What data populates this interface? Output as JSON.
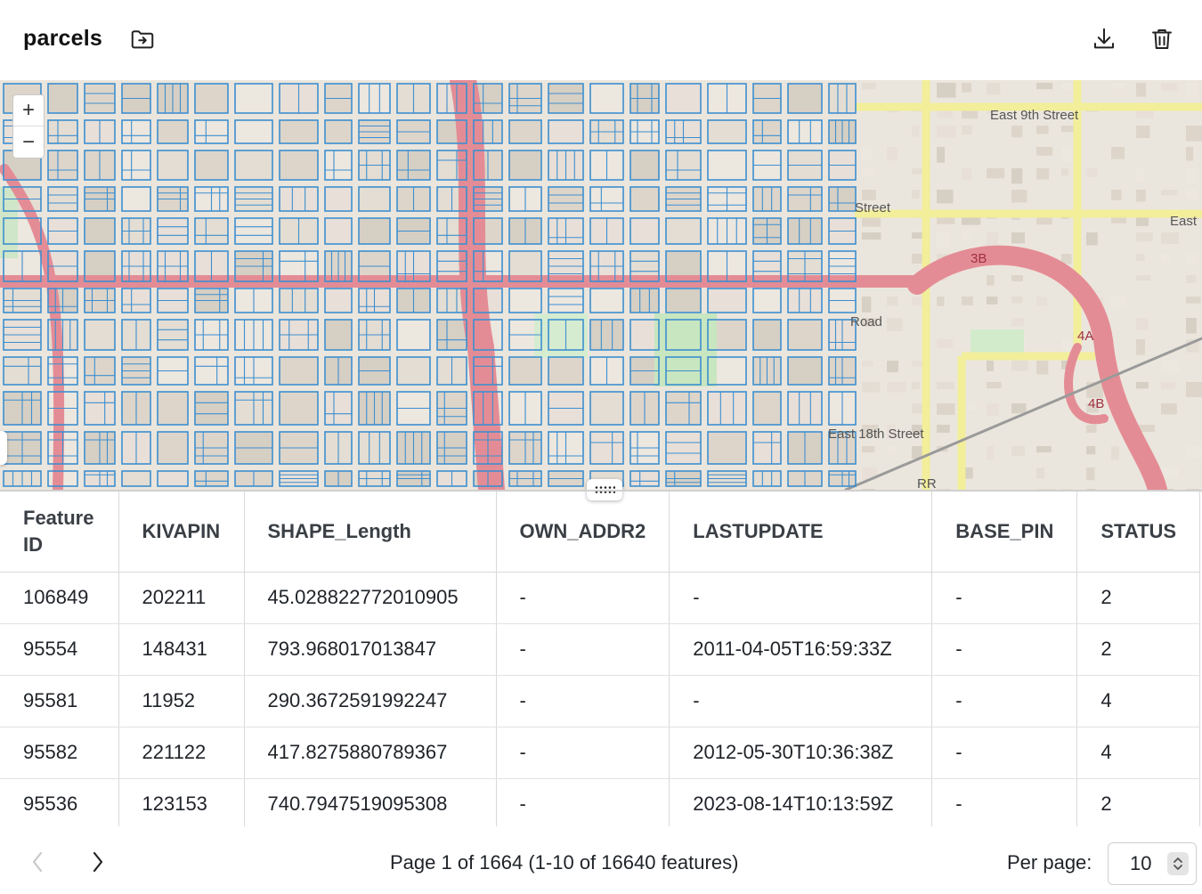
{
  "layer": {
    "title": "parcels"
  },
  "icons": {
    "move": "folder-move-icon",
    "download": "download-icon",
    "delete": "trash-icon"
  },
  "map": {
    "zoom_in": "+",
    "zoom_out": "−",
    "labels": [
      "East 9th Street",
      "3B",
      "4A",
      "4B",
      "East 18th Street",
      "East",
      "Street",
      "Road",
      "RR"
    ]
  },
  "colors": {
    "parcel_outline": "#3d8fd0",
    "highway": "#e58a92",
    "arterial": "#f7f4a0",
    "park": "#c8e6c0"
  },
  "table": {
    "columns": [
      "Feature ID",
      "KIVAPIN",
      "SHAPE_Length",
      "OWN_ADDR2",
      "LASTUPDATE",
      "BASE_PIN",
      "STATUS"
    ],
    "rows": [
      [
        "106849",
        "202211",
        "45.028822772010905",
        "-",
        "-",
        "-",
        "2"
      ],
      [
        "95554",
        "148431",
        "793.968017013847",
        "-",
        "2011-04-05T16:59:33Z",
        "-",
        "2"
      ],
      [
        "95581",
        "11952",
        "290.3672591992247",
        "-",
        "-",
        "-",
        "4"
      ],
      [
        "95582",
        "221122",
        "417.8275880789367",
        "-",
        "2012-05-30T10:36:38Z",
        "-",
        "4"
      ],
      [
        "95536",
        "123153",
        "740.7947519095308",
        "-",
        "2023-08-14T10:13:59Z",
        "-",
        "2"
      ]
    ]
  },
  "pagination": {
    "info": "Page 1 of 1664 (1-10 of 16640 features)",
    "per_page_label": "Per page:",
    "per_page_value": "10"
  }
}
